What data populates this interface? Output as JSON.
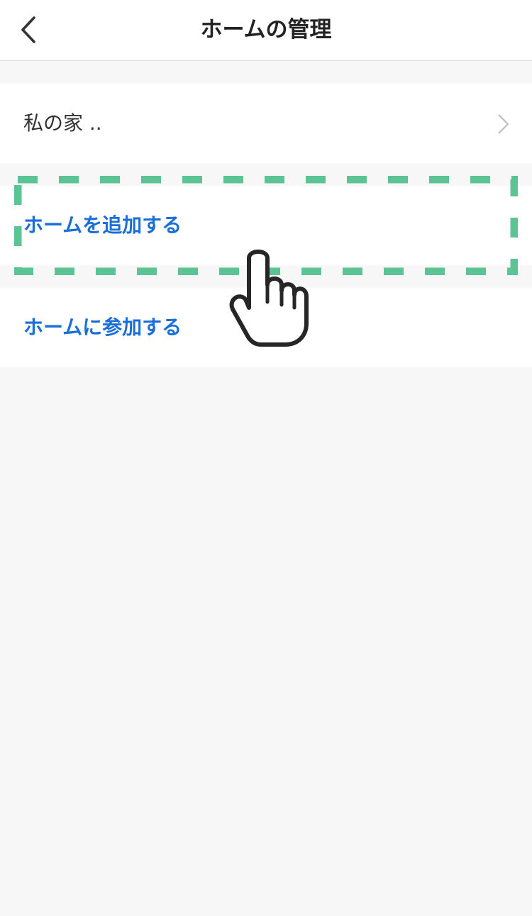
{
  "header": {
    "title": "ホームの管理",
    "back_icon": "chevron-left-icon"
  },
  "homes": [
    {
      "name": "私の家 ..",
      "chevron_icon": "chevron-right-icon"
    }
  ],
  "actions": {
    "add_home": "ホームを追加する",
    "join_home": "ホームに参加する"
  },
  "overlay": {
    "highlight_target": "add_home",
    "hand_icon": "pointing-hand-icon"
  },
  "colors": {
    "background": "#f7f7f7",
    "surface": "#ffffff",
    "title_text": "#222222",
    "body_text": "#333333",
    "link": "#1a6ed8",
    "highlight": "#5cc394",
    "chevron": "#c4c4c4"
  }
}
